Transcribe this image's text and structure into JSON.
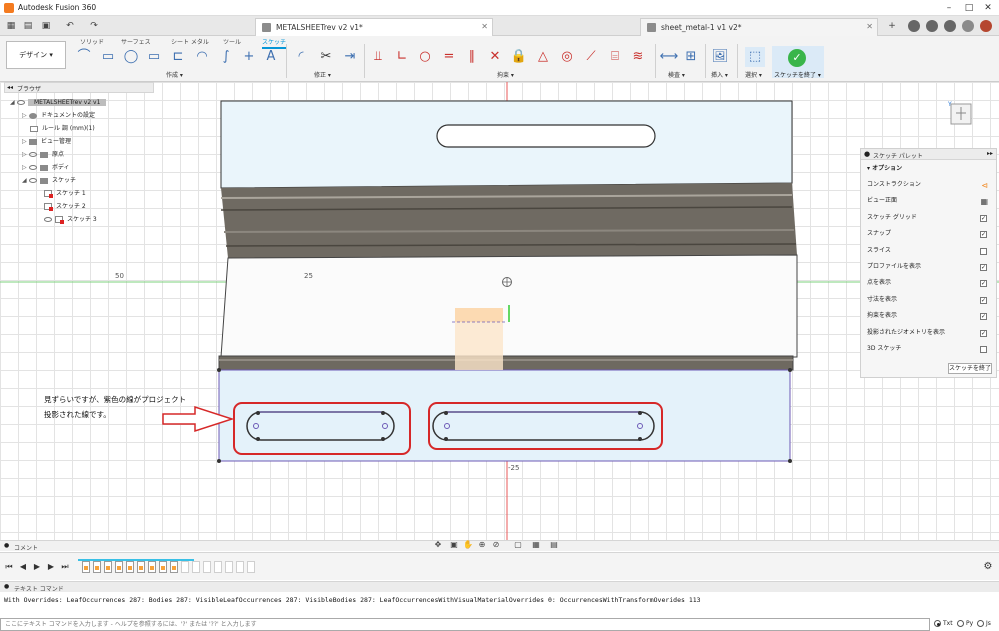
{
  "app": {
    "title": "Autodesk Fusion 360"
  },
  "tabs": [
    {
      "label": "METALSHEETrev v2 v1*",
      "active": true
    },
    {
      "label": "sheet_metal-1 v1 v2*",
      "active": false
    }
  ],
  "ribbon": {
    "tabs": [
      "ソリッド",
      "サーフェス",
      "シート メタル",
      "ツール",
      "スケッチ"
    ],
    "active_tab": "スケッチ",
    "workspace": "デザイン ▾",
    "groups": [
      "作成 ▾",
      "修正 ▾",
      "拘束 ▾",
      "検査 ▾",
      "挿入 ▾",
      "選択 ▾"
    ],
    "finish": "スケッチを終了 ▾"
  },
  "browser": {
    "title": "ブラウザ",
    "root": "METALSHEETrev v2 v1",
    "items": [
      {
        "label": "ドキュメントの設定"
      },
      {
        "label": "ルール 調 (mm)(1)"
      },
      {
        "label": "ビュー管理"
      },
      {
        "label": "原点"
      },
      {
        "label": "ボディ"
      },
      {
        "label": "スケッチ"
      },
      {
        "label": "スケッチ 1"
      },
      {
        "label": "スケッチ 2"
      },
      {
        "label": "スケッチ 3"
      }
    ]
  },
  "palette": {
    "title": "スケッチ パレット",
    "section": "▾ オプション",
    "options": [
      {
        "label": "コンストラクション",
        "type": "icon",
        "icon": "construction-icon"
      },
      {
        "label": "ビュー正面",
        "type": "icon",
        "icon": "look-at-icon"
      },
      {
        "label": "スケッチ グリッド",
        "type": "check",
        "checked": true,
        "mark": "✓"
      },
      {
        "label": "スナップ",
        "type": "check",
        "checked": true,
        "mark": "✓"
      },
      {
        "label": "スライス",
        "type": "check",
        "checked": false,
        "mark": ""
      },
      {
        "label": "プロファイルを表示",
        "type": "check",
        "checked": true,
        "mark": "✓"
      },
      {
        "label": "点を表示",
        "type": "check",
        "checked": true,
        "mark": "✓"
      },
      {
        "label": "寸法を表示",
        "type": "check",
        "checked": true,
        "mark": "✓"
      },
      {
        "label": "拘束を表示",
        "type": "check",
        "checked": true,
        "mark": "✓"
      },
      {
        "label": "投影されたジオメトリを表示",
        "type": "check",
        "checked": true,
        "mark": "✓"
      },
      {
        "label": "3D スケッチ",
        "type": "check",
        "checked": false,
        "mark": ""
      }
    ],
    "finish": "スケッチを終了"
  },
  "canvas": {
    "dims": {
      "d50": "50",
      "d25": "25",
      "dm25": "-25"
    },
    "annotation": {
      "line1": "見ずらいですが、紫色の線がプロジェクト",
      "line2": "投影された線です。"
    },
    "colors": {
      "highlight": "#d62828",
      "projected": "#6c5ab6",
      "sheet": "#eaf5fb",
      "axis": "#e85a5a"
    }
  },
  "comment": {
    "label": "コメント"
  },
  "textcommands": {
    "title": "テキスト コマンド",
    "output": "With Overrides: LeafOccurrences 287: Bodies 287: VisibleLeafOccurrences 287: VisibleBodies 287: LeafOccurrencesWithVisualMaterialOverrides 0: OccurrencesWithTransformOverides 113",
    "placeholder": "ここにテキスト コマンドを入力します - ヘルプを参照するには、'?' または '??' と入力します",
    "modes": [
      "Txt",
      "Py",
      "Js"
    ],
    "active_mode": "Txt"
  }
}
